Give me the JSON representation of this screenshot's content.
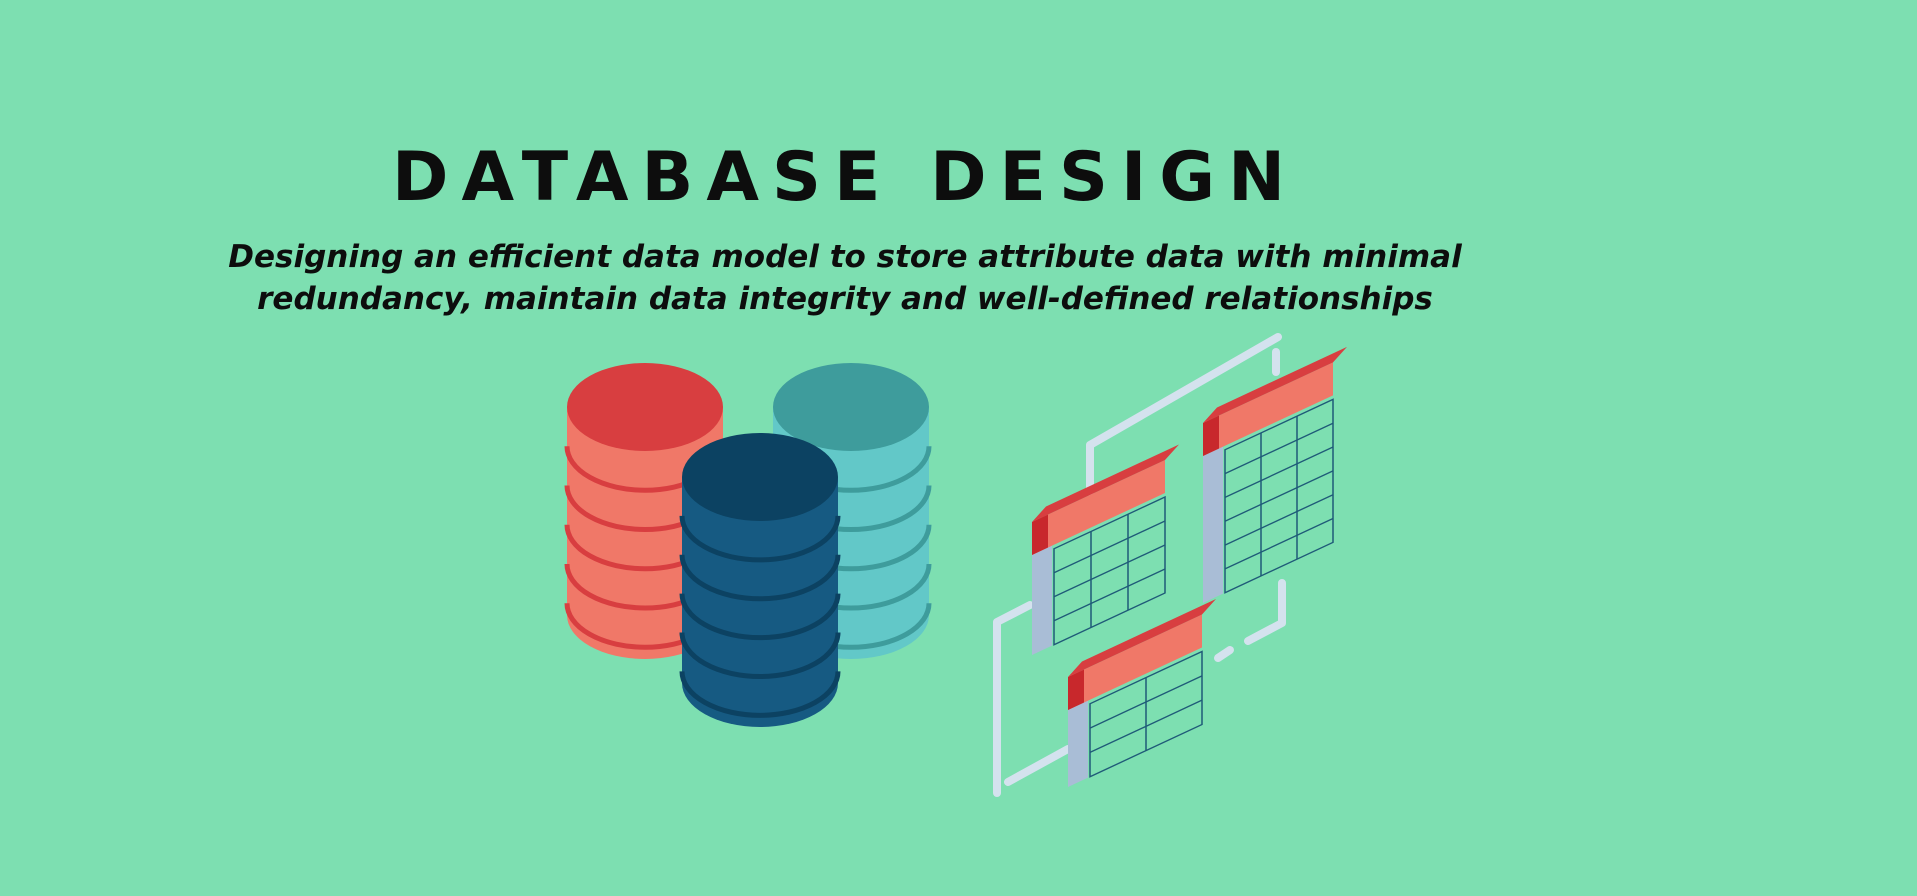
{
  "header": {
    "title": "DATABASE DESIGN",
    "subtitle_line1": "Designing an efficient data model to store attribute data with minimal",
    "subtitle_line2": "redundancy, maintain data integrity and well-defined relationships"
  },
  "illustration": {
    "colors": {
      "background": "#7ddfb1",
      "red_top": "#d83e40",
      "red_body": "#f07868",
      "teal_top": "#3e9c9c",
      "teal_body": "#62c8c8",
      "blue_top": "#0c4262",
      "blue_body": "#165a82",
      "connector": "#d4e2ee",
      "table_header": "#f07868",
      "table_header_dark": "#d83e40",
      "grid_line": "#1f5a78"
    }
  }
}
